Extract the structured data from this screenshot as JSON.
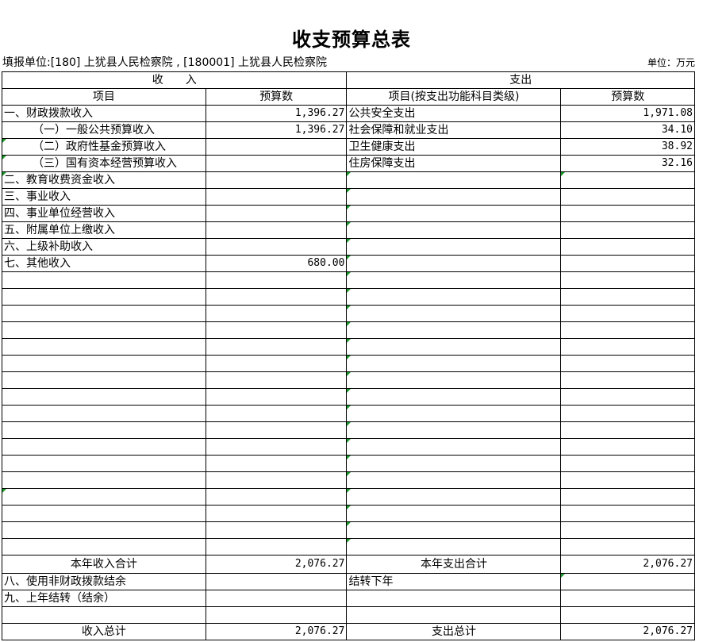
{
  "title": "收支预算总表",
  "unit_line": "填报单位:[180] 上犹县人民检察院 , [180001] 上犹县人民检察院",
  "unit_label": "单位：万元",
  "header": {
    "income": "收　　入",
    "expense": "支出",
    "income_item": "项目",
    "income_amount": "预算数",
    "expense_item": "项目(按支出功能科目类级)",
    "expense_amount": "预算数"
  },
  "rows": [
    {
      "in_item": "一、财政拨款收入",
      "in_val": "1,396.27",
      "ex_item": "公共安全支出",
      "ex_val": "1,971.08"
    },
    {
      "in_item": "（一）一般公共预算收入",
      "in_val": "1,396.27",
      "ex_item": "社会保障和就业支出",
      "ex_val": "34.10"
    },
    {
      "in_item": "（二）政府性基金预算收入",
      "in_val": "",
      "ex_item": "卫生健康支出",
      "ex_val": "38.92"
    },
    {
      "in_item": "（三）国有资本经营预算收入",
      "in_val": "",
      "ex_item": "住房保障支出",
      "ex_val": "32.16"
    },
    {
      "in_item": "二、教育收费资金收入",
      "in_val": "",
      "ex_item": "",
      "ex_val": ""
    },
    {
      "in_item": "三、事业收入",
      "in_val": "",
      "ex_item": "",
      "ex_val": ""
    },
    {
      "in_item": "四、事业单位经营收入",
      "in_val": "",
      "ex_item": "",
      "ex_val": ""
    },
    {
      "in_item": "五、附属单位上缴收入",
      "in_val": "",
      "ex_item": "",
      "ex_val": ""
    },
    {
      "in_item": "六、上级补助收入",
      "in_val": "",
      "ex_item": "",
      "ex_val": ""
    },
    {
      "in_item": "七、其他收入",
      "in_val": "680.00",
      "ex_item": "",
      "ex_val": ""
    }
  ],
  "totals": {
    "in_year_label": "本年收入合计",
    "in_year_val": "2,076.27",
    "ex_year_label": "本年支出合计",
    "ex_year_val": "2,076.27",
    "row8_label": "八、使用非财政拨款结余",
    "carry_label": "结转下年",
    "row9_label": "九、上年结转（结余）",
    "in_total_label": "收入总计",
    "in_total_val": "2,076.27",
    "ex_total_label": "支出总计",
    "ex_total_val": "2,076.27"
  },
  "colors": {
    "cell_marker": "#1a9a2a"
  }
}
